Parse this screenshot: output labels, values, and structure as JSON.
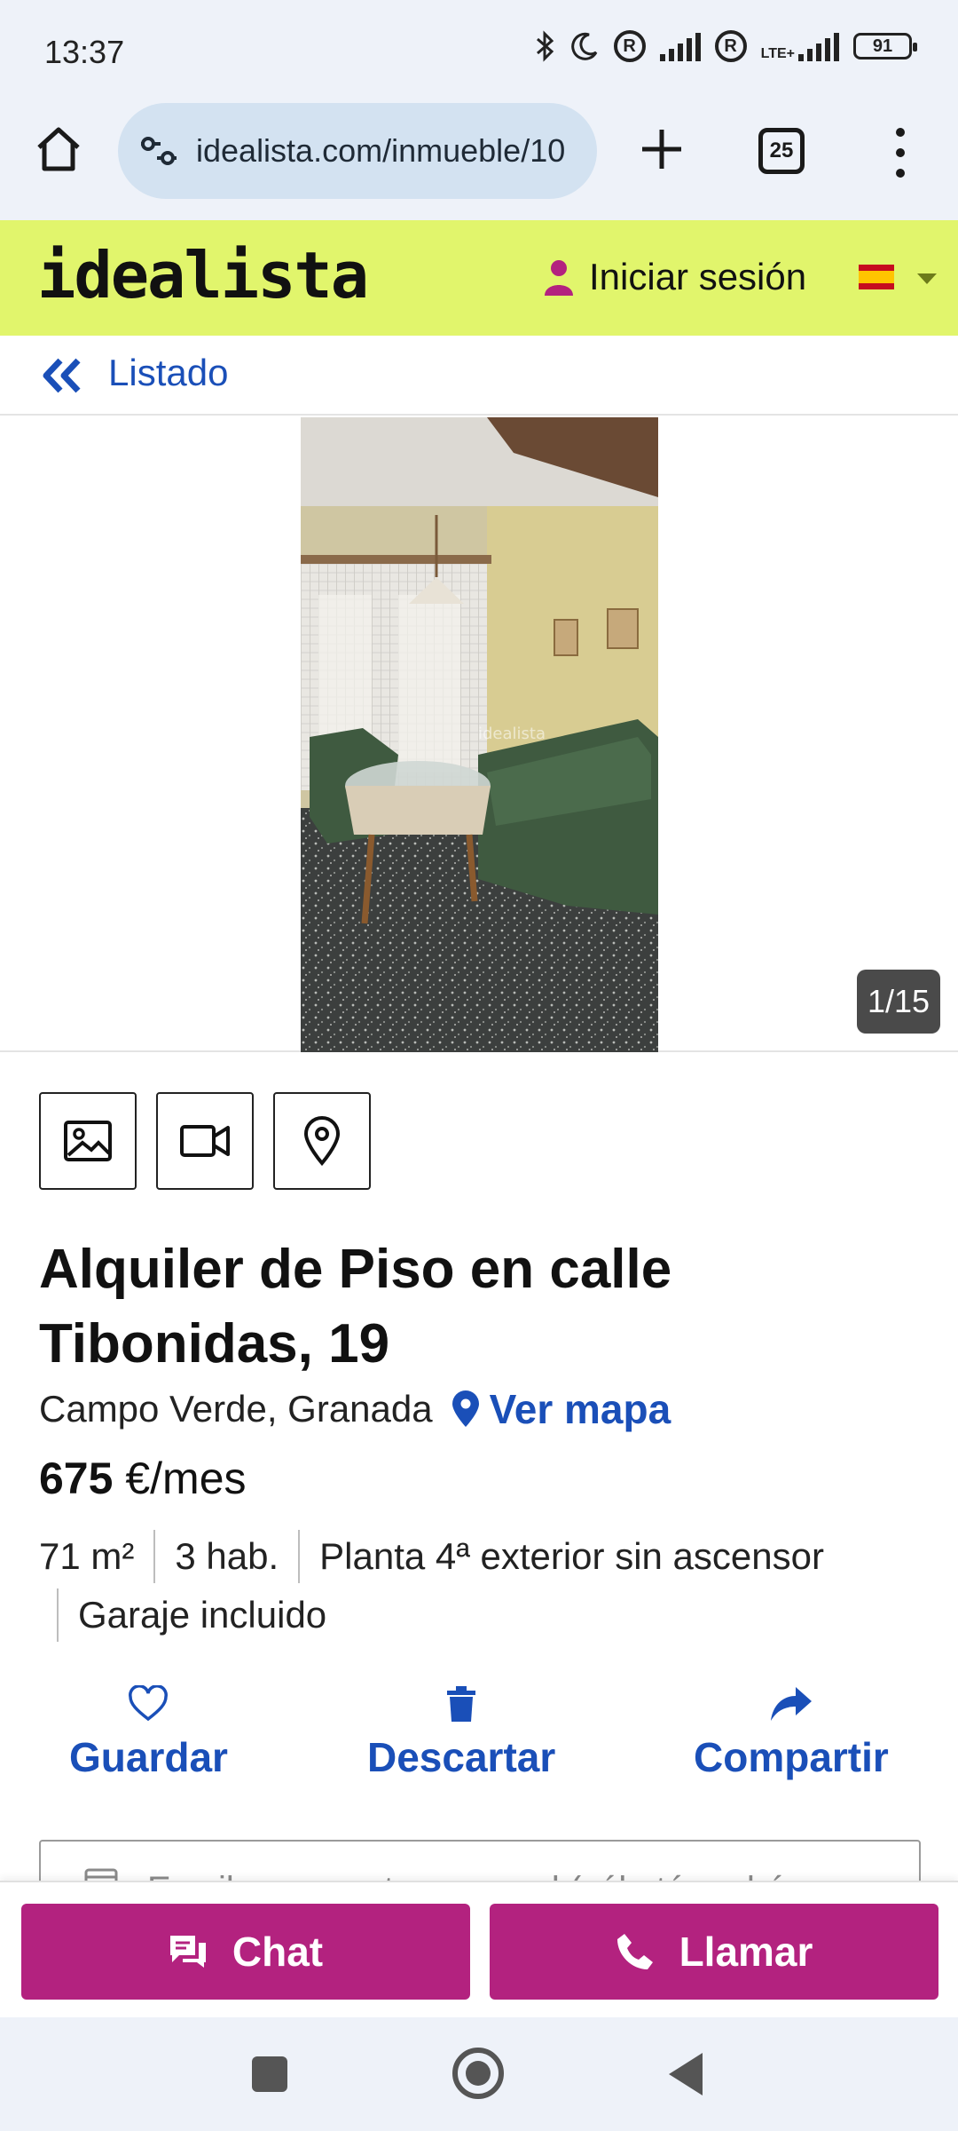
{
  "status_bar": {
    "time": "13:37",
    "network": "LTE+",
    "battery": "91"
  },
  "browser": {
    "url": "idealista.com/inmueble/10",
    "tab_count": "25",
    "icons": [
      "home-icon",
      "site-settings-icon",
      "plus-icon",
      "tabs-icon",
      "more-vert-icon"
    ]
  },
  "header": {
    "logo": "idealista",
    "login_label": "Iniciar sesión",
    "colors": {
      "header_bg": "#e1f56c",
      "accent": "#b3227f",
      "link": "#1a4fb8"
    }
  },
  "nav": {
    "back_label": "Listado"
  },
  "gallery": {
    "counter": "1/15",
    "watermark": "idealista"
  },
  "listing": {
    "title": "Alquiler de Piso en calle Tibonidas, 19",
    "location": "Campo Verde, Granada",
    "map_link": "Ver mapa",
    "price_amount": "675",
    "price_unit": "€/mes",
    "features_line1": [
      "71 m²",
      "3 hab.",
      "Planta 4ª exterior sin ascensor"
    ],
    "features_line2": [
      "Garaje incluido"
    ]
  },
  "actions": {
    "save": "Guardar",
    "discard": "Descartar",
    "share": "Compartir"
  },
  "note": {
    "placeholder": "Escribe una nota personal (sólo tú podrás"
  },
  "cta": {
    "chat": "Chat",
    "call": "Llamar"
  }
}
